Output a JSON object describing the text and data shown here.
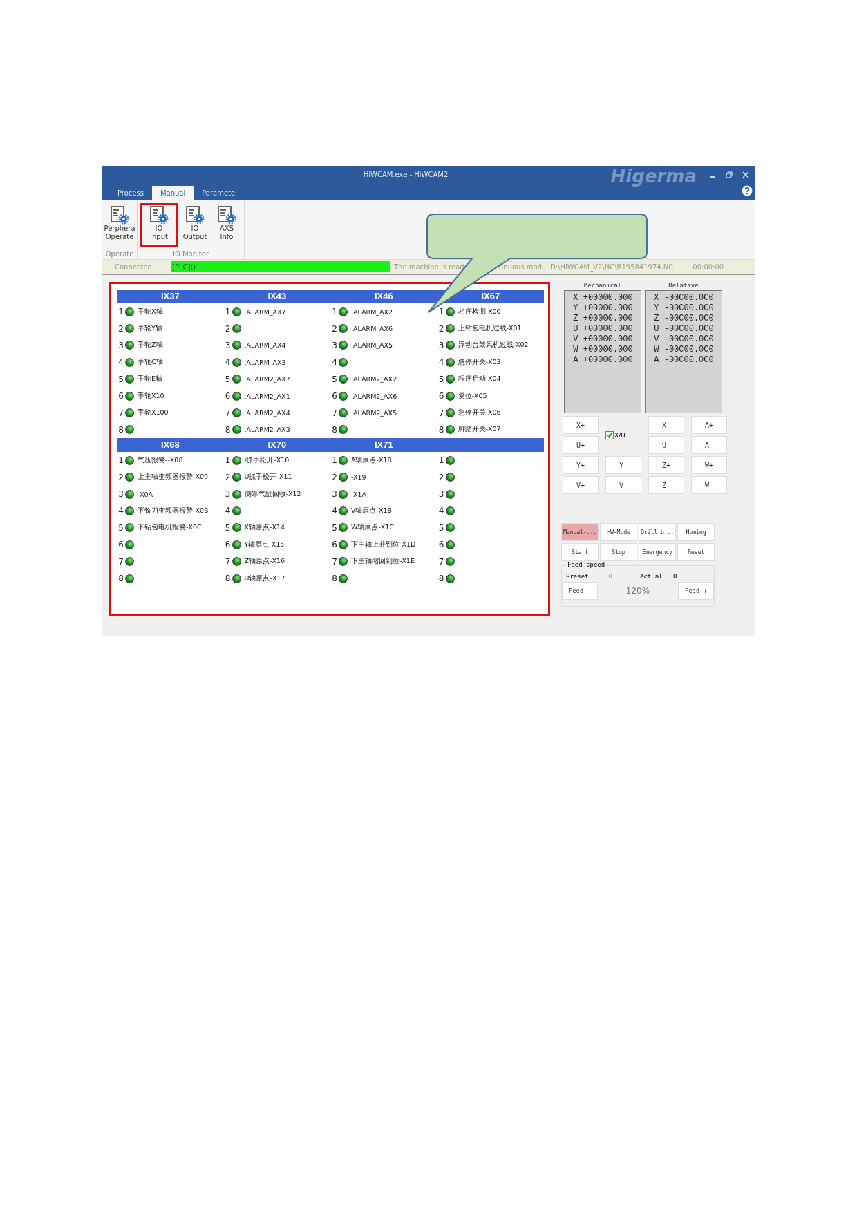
{
  "window": {
    "title": "HiWCAM.exe - HiWCAM2",
    "logo_text": "Higerma"
  },
  "tabs": [
    {
      "label": "Process",
      "selected": false
    },
    {
      "label": "Manual",
      "selected": true
    },
    {
      "label": "Paramete",
      "selected": false
    }
  ],
  "ribbon": [
    {
      "label": "Operate",
      "buttons": [
        {
          "lines": [
            "Perphera",
            "Operate"
          ],
          "highlighted": false
        }
      ]
    },
    {
      "label": "IO Monitor",
      "buttons": [
        {
          "lines": [
            "IO",
            "Input"
          ],
          "highlighted": true
        },
        {
          "lines": [
            "IO",
            "Output"
          ],
          "highlighted": false
        },
        {
          "lines": [
            "AXS",
            "Info"
          ],
          "highlighted": false
        }
      ]
    }
  ],
  "status_bar": {
    "connection": "Connected",
    "plc": "[PLC]()",
    "message": "The machine is read",
    "mode": "tinuous mod",
    "path": "D:\\HiWCAM_V2\\NC\\B195841974.NC",
    "time": "00:00:00"
  },
  "io_blocks": [
    {
      "columns": [
        {
          "header": "IX37",
          "rows": [
            {
              "num": "1",
              "label": "手轮X轴",
              "on": true
            },
            {
              "num": "2",
              "label": "手轮Y轴",
              "on": true
            },
            {
              "num": "3",
              "label": "手轮Z轴",
              "on": true
            },
            {
              "num": "4",
              "label": "手轮C轴",
              "on": true
            },
            {
              "num": "5",
              "label": "手轮E轴",
              "on": true
            },
            {
              "num": "6",
              "label": "手轮X10",
              "on": true
            },
            {
              "num": "7",
              "label": "手轮X100",
              "on": true
            },
            {
              "num": "8",
              "label": "",
              "on": true
            }
          ]
        },
        {
          "header": "IX43",
          "rows": [
            {
              "num": "1",
              "label": ".ALARM_AX7",
              "on": true
            },
            {
              "num": "2",
              "label": "",
              "on": true
            },
            {
              "num": "3",
              "label": ".ALARM_AX4",
              "on": true
            },
            {
              "num": "4",
              "label": ".ALARM_AX3",
              "on": true
            },
            {
              "num": "5",
              "label": ".ALARM2_AX7",
              "on": true
            },
            {
              "num": "6",
              "label": ".ALARM2_AX1",
              "on": true
            },
            {
              "num": "7",
              "label": ".ALARM2_AX4",
              "on": true
            },
            {
              "num": "8",
              "label": ".ALARM2_AX3",
              "on": true
            }
          ]
        },
        {
          "header": "IX46",
          "rows": [
            {
              "num": "1",
              "label": ".ALARM_AX2",
              "on": true
            },
            {
              "num": "2",
              "label": ".ALARM_AX6",
              "on": true
            },
            {
              "num": "3",
              "label": ".ALARM_AX5",
              "on": true
            },
            {
              "num": "4",
              "label": "",
              "on": true
            },
            {
              "num": "5",
              "label": ".ALARM2_AX2",
              "on": true
            },
            {
              "num": "6",
              "label": ".ALARM2_AX6",
              "on": true
            },
            {
              "num": "7",
              "label": ".ALARM2_AX5",
              "on": true
            },
            {
              "num": "8",
              "label": "",
              "on": true
            }
          ]
        },
        {
          "header": "IX67",
          "rows": [
            {
              "num": "1",
              "label": "相序检测-X00",
              "on": true
            },
            {
              "num": "2",
              "label": "上钻包电机过载-X01",
              "on": true
            },
            {
              "num": "3",
              "label": "浮动台鼓风机过载-X02",
              "on": true
            },
            {
              "num": "4",
              "label": "急停开关-X03",
              "on": true
            },
            {
              "num": "5",
              "label": "程序启动-X04",
              "on": true
            },
            {
              "num": "6",
              "label": "复位-X05",
              "on": true
            },
            {
              "num": "7",
              "label": "急停开关-X06",
              "on": true
            },
            {
              "num": "8",
              "label": "脚踏开关-X07",
              "on": true
            }
          ]
        }
      ]
    },
    {
      "columns": [
        {
          "header": "IX68",
          "rows": [
            {
              "num": "1",
              "label": "气压报警--X08",
              "on": true
            },
            {
              "num": "2",
              "label": "上主轴变频器报警-X09",
              "on": true
            },
            {
              "num": "3",
              "label": "-X0A",
              "on": true
            },
            {
              "num": "4",
              "label": "下铣刀变频器报警-X0B",
              "on": true
            },
            {
              "num": "5",
              "label": "下钻包电机报警-X0C",
              "on": true
            },
            {
              "num": "6",
              "label": "",
              "on": true
            },
            {
              "num": "7",
              "label": "",
              "on": true
            },
            {
              "num": "8",
              "label": "",
              "on": true
            }
          ]
        },
        {
          "header": "IX70",
          "rows": [
            {
              "num": "1",
              "label": "I抓手松开-X10",
              "on": true
            },
            {
              "num": "2",
              "label": "U抓手松开-X11",
              "on": true
            },
            {
              "num": "3",
              "label": "侧靠气缸回收-X12",
              "on": true
            },
            {
              "num": "4",
              "label": "",
              "on": true
            },
            {
              "num": "5",
              "label": "X轴原点-X14",
              "on": true
            },
            {
              "num": "6",
              "label": "Y轴原点-X15",
              "on": true
            },
            {
              "num": "7",
              "label": "Z轴原点-X16",
              "on": true
            },
            {
              "num": "8",
              "label": "U轴原点-X17",
              "on": true
            }
          ]
        },
        {
          "header": "IX71",
          "rows": [
            {
              "num": "1",
              "label": "A轴原点-X18",
              "on": true
            },
            {
              "num": "2",
              "label": "-X19",
              "on": true
            },
            {
              "num": "3",
              "label": "-X1A",
              "on": true
            },
            {
              "num": "4",
              "label": "V轴原点-X1B",
              "on": true
            },
            {
              "num": "5",
              "label": "W轴原点-X1C",
              "on": true
            },
            {
              "num": "6",
              "label": "下主轴上升到位-X1D",
              "on": true
            },
            {
              "num": "7",
              "label": "下主轴缩回到位-X1E",
              "on": true
            },
            {
              "num": "8",
              "label": "",
              "on": true
            }
          ]
        },
        {
          "rows": [
            {
              "num": "1",
              "label": "",
              "on": true
            },
            {
              "num": "2",
              "label": "",
              "on": true
            },
            {
              "num": "3",
              "label": "",
              "on": true
            },
            {
              "num": "4",
              "label": "",
              "on": true
            },
            {
              "num": "5",
              "label": "",
              "on": true
            },
            {
              "num": "6",
              "label": "",
              "on": true
            },
            {
              "num": "7",
              "label": "",
              "on": true
            },
            {
              "num": "8",
              "label": "",
              "on": true
            }
          ]
        }
      ]
    }
  ],
  "positions": [
    {
      "title": "Mechanical",
      "lines": [
        "X +00000.000",
        "Y +00000.000",
        "Z +00000.000",
        "U +00000.000",
        "V +00000.000",
        "W +00000.000",
        "A +00000.000"
      ]
    },
    {
      "title": "Relative",
      "lines": [
        "X -00C00.0C0",
        "Y -00C00.0C0",
        "Z -00C00.0C0",
        "U -00C00.0C0",
        "V -00C00.0C0",
        "W -00C00.0C0",
        "A -00C00.0C0"
      ]
    }
  ],
  "jog": [
    {
      "kind": "button",
      "label": "X+"
    },
    {
      "kind": "checkbox",
      "label": "X/U",
      "checked": true
    },
    {
      "kind": "button",
      "label": "X-"
    },
    {
      "kind": "button",
      "label": "A+"
    },
    {
      "kind": "button",
      "label": "U+"
    },
    {
      "kind": "blank"
    },
    {
      "kind": "button",
      "label": "U-"
    },
    {
      "kind": "button",
      "label": "A-"
    },
    {
      "kind": "button",
      "label": "Y+"
    },
    {
      "kind": "button",
      "label": "Y-"
    },
    {
      "kind": "button",
      "label": "Z+"
    },
    {
      "kind": "button",
      "label": "W+"
    },
    {
      "kind": "button",
      "label": "V+"
    },
    {
      "kind": "button",
      "label": "V-"
    },
    {
      "kind": "button",
      "label": "Z-"
    },
    {
      "kind": "button",
      "label": "W-"
    }
  ],
  "mode_buttons": [
    {
      "label": "Manual-...",
      "selected": true
    },
    {
      "label": "HW-Mode",
      "selected": false
    },
    {
      "label": "Drill b...",
      "selected": false
    },
    {
      "label": "Homing",
      "selected": false
    }
  ],
  "action_buttons": [
    "Start",
    "Stop",
    "Emergency",
    "Reset"
  ],
  "feed": {
    "title": "Feed speed",
    "preset_label": "Preset",
    "preset": "0",
    "actual_label": "Actual",
    "actual": "0",
    "minus": "Feed -",
    "percent": "120%",
    "plus": "Feed +"
  }
}
